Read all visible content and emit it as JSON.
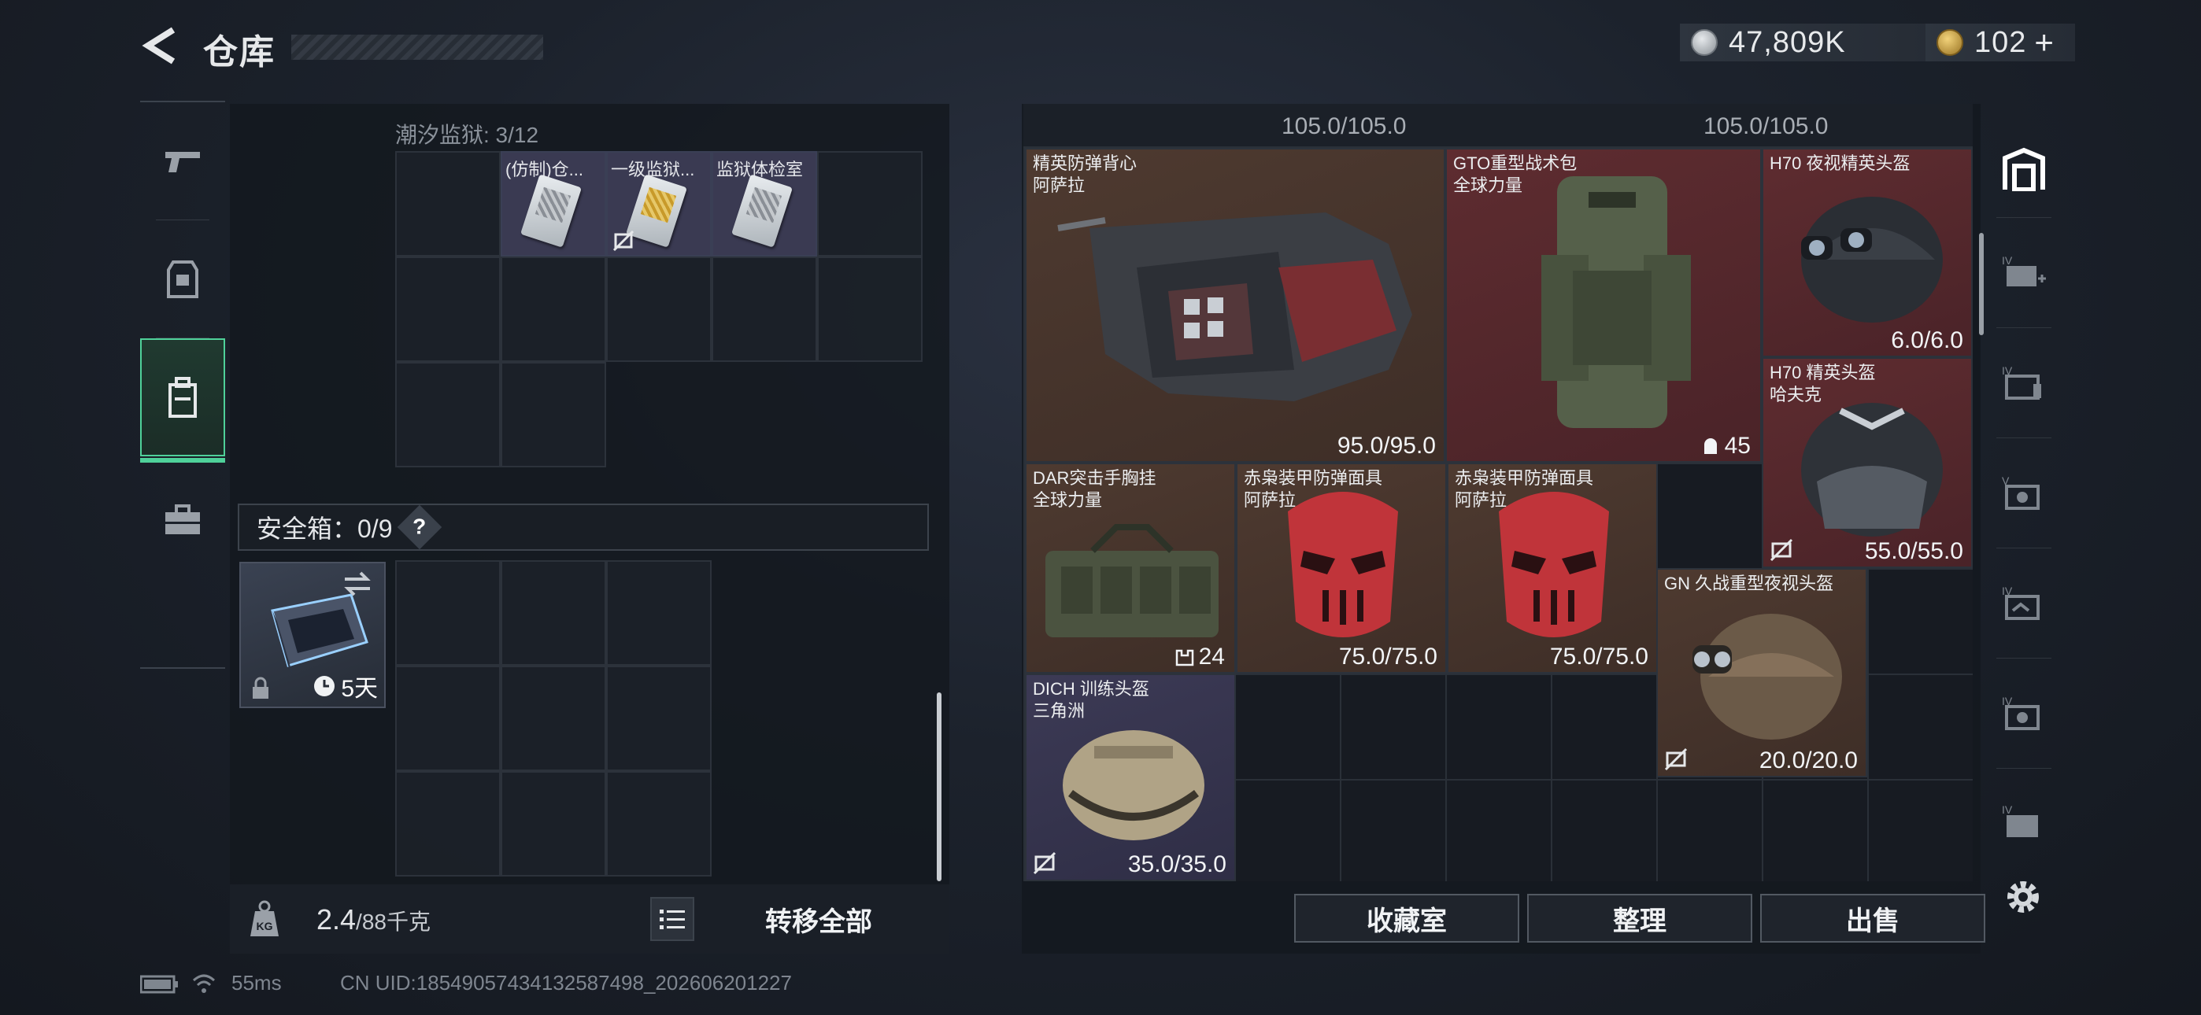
{
  "header": {
    "title": "仓库",
    "currency_silver": "47,809K",
    "currency_gold": "102",
    "add_label": "+"
  },
  "left_tabs": [
    "pistol-icon",
    "armor-icon",
    "backpack-icon",
    "toolbox-icon"
  ],
  "left_panel": {
    "section_label": "潮汐监狱: 3/12",
    "items": [
      {
        "name": "(仿制)仓..."
      },
      {
        "name": "一级监狱..."
      },
      {
        "name": "监狱体检室"
      }
    ],
    "safebox_label": "安全箱：0/9",
    "safebox_help": "?",
    "safe_item_time": "5天",
    "weight_current": "2.4",
    "weight_max": "/88千克",
    "transfer_all": "转移全部"
  },
  "right_panel": {
    "strip_values": [
      "105.0/105.0",
      "105.0/105.0"
    ],
    "items": [
      {
        "name": "精英防弹背心\n阿萨拉",
        "value": "95.0/95.0"
      },
      {
        "name": "GTO重型战术包\n全球力量",
        "value": "45"
      },
      {
        "name": "H70 夜视精英头盔",
        "value": "6.0/6.0"
      },
      {
        "name": "H70 精英头盔\n哈夫克",
        "value": "55.0/55.0"
      },
      {
        "name": "DAR突击手胸挂\n全球力量",
        "value": "24"
      },
      {
        "name": "赤枭装甲防弹面具\n阿萨拉",
        "value": "75.0/75.0"
      },
      {
        "name": "赤枭装甲防弹面具\n阿萨拉",
        "value": "75.0/75.0"
      },
      {
        "name": "GN 久战重型夜视头盔",
        "value": "20.0/20.0"
      },
      {
        "name": "DICH 训练头盔\n三角洲",
        "value": "35.0/35.0"
      }
    ],
    "buttons": {
      "collection": "收藏室",
      "organize": "整理",
      "sell": "出售"
    }
  },
  "status_bar": {
    "ping": "55ms",
    "uid": "CN UID:1854905743413258749​8_202606201227"
  },
  "colors": {
    "accent_green": "#4fd19a",
    "item_red": "#5e2c30",
    "item_brown": "#4e3a30",
    "item_purple": "#3c3a55"
  }
}
